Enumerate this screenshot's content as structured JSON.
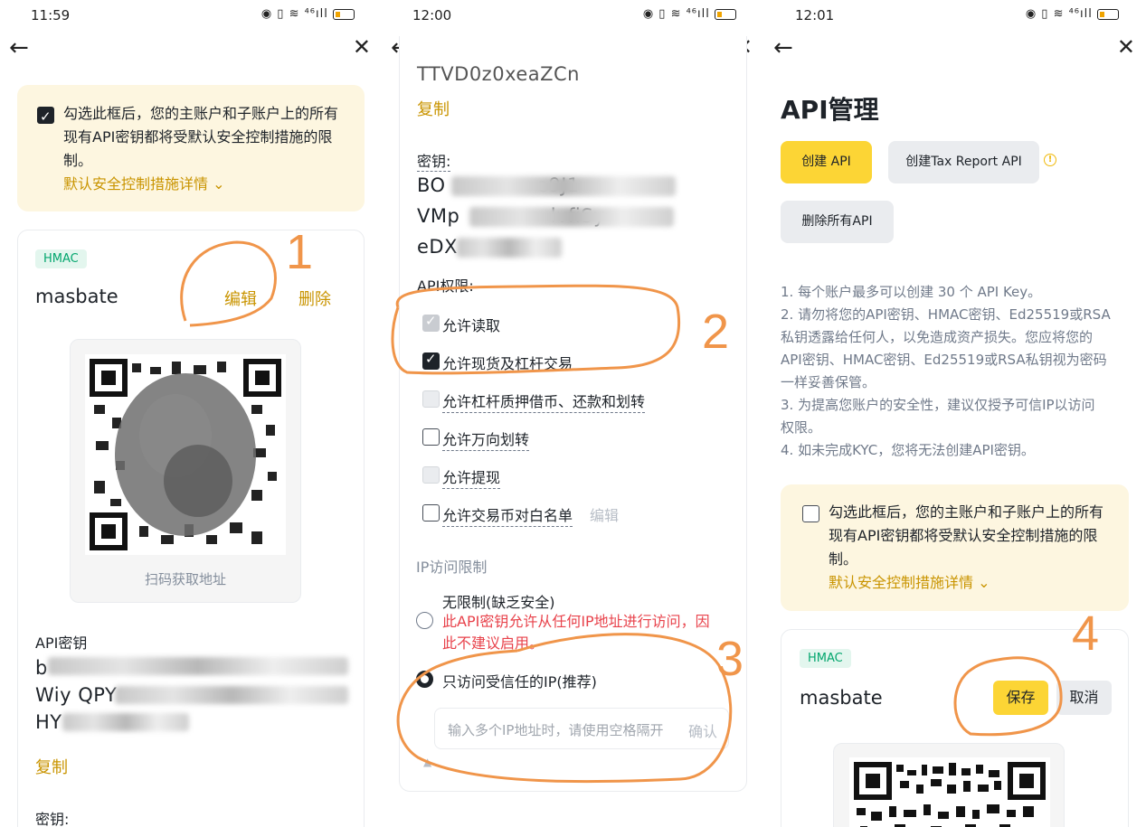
{
  "panel1": {
    "status_time": "11:59",
    "warning": {
      "text_lines": [
        "勾选此框后，您的主账户和子账户上的所有",
        "现有API密钥都将受默认安全控制措施的限",
        "制。"
      ],
      "details_link": "默认安全控制措施详情 ⌄"
    },
    "card": {
      "tag": "HMAC",
      "name": "masbate",
      "edit_label": "编辑",
      "delete_label": "删除",
      "qr_caption": "扫码获取地址",
      "api_key_label": "API密钥",
      "api_key_lines": [
        "b",
        "Wiy QPY",
        "HY"
      ],
      "copy_label": "复制",
      "secret_label": "密钥:"
    },
    "annotation": "1"
  },
  "panel2": {
    "status_time": "12:00",
    "top_text": "TTVD0z0xeaZCn",
    "copy_label": "复制",
    "secret_label": "密钥:",
    "secret_lines": [
      "BO              e9J1",
      "VMp              lvfiSy",
      "eDX"
    ],
    "permissions_label": "API权限:",
    "permissions": [
      {
        "label": "允许读取",
        "checked": true,
        "style": "grey"
      },
      {
        "label": "允许现货及杠杆交易",
        "checked": true,
        "style": "dark"
      },
      {
        "label": "允许杠杆质押借币、还款和划转",
        "checked": false,
        "style": "disabled"
      },
      {
        "label": "允许万向划转",
        "checked": false,
        "style": "normal"
      },
      {
        "label": "允许提现",
        "checked": false,
        "style": "disabled"
      },
      {
        "label": "允许交易币对白名单",
        "checked": false,
        "style": "normal"
      }
    ],
    "whitelist_edit": "编辑",
    "ip_label": "IP访问限制",
    "ip_unrestricted": "无限制(缺乏安全)",
    "ip_warning_lines": [
      "此API密钥允许从任何IP地址进行访问，因",
      "此不建议启用。"
    ],
    "ip_trusted": "只访问受信任的IP(推荐)",
    "ip_input_placeholder": "输入多个IP地址时，请使用空格隔开",
    "ip_confirm": "确认",
    "annotation_2": "2",
    "annotation_3": "3"
  },
  "panel3": {
    "status_time": "12:01",
    "page_title": "API管理",
    "create_api": "创建 API",
    "create_tax_api": "创建Tax Report API",
    "delete_all": "删除所有API",
    "notes": [
      "1. 每个账户最多可以创建 30 个 API Key。",
      "2. 请勿将您的API密钥、HMAC密钥、Ed25519或RSA",
      "私钥透露给任何人，以免造成资产损失。您应将您的",
      "API密钥、HMAC密钥、Ed25519或RSA私钥视为密码",
      "一样妥善保管。",
      "3. 为提高您账户的安全性，建议仅授予可信IP以访问",
      "权限。",
      "4. 如未完成KYC，您将无法创建API密钥。"
    ],
    "warning": {
      "text_lines": [
        "勾选此框后，您的主账户和子账户上的所有",
        "现有API密钥都将受默认安全控制措施的限",
        "制。"
      ],
      "details_link": "默认安全控制措施详情 ⌄"
    },
    "card": {
      "tag": "HMAC",
      "name": "masbate",
      "save_label": "保存",
      "cancel_label": "取消"
    },
    "annotation": "4"
  },
  "colors": {
    "accent_yellow": "#fcd535",
    "gold_text": "#c99400",
    "annotation_orange": "#f0954a",
    "warning_bg": "#fdf6e0",
    "danger_red": "#e8424b",
    "hmac_green": "#03a66d"
  }
}
